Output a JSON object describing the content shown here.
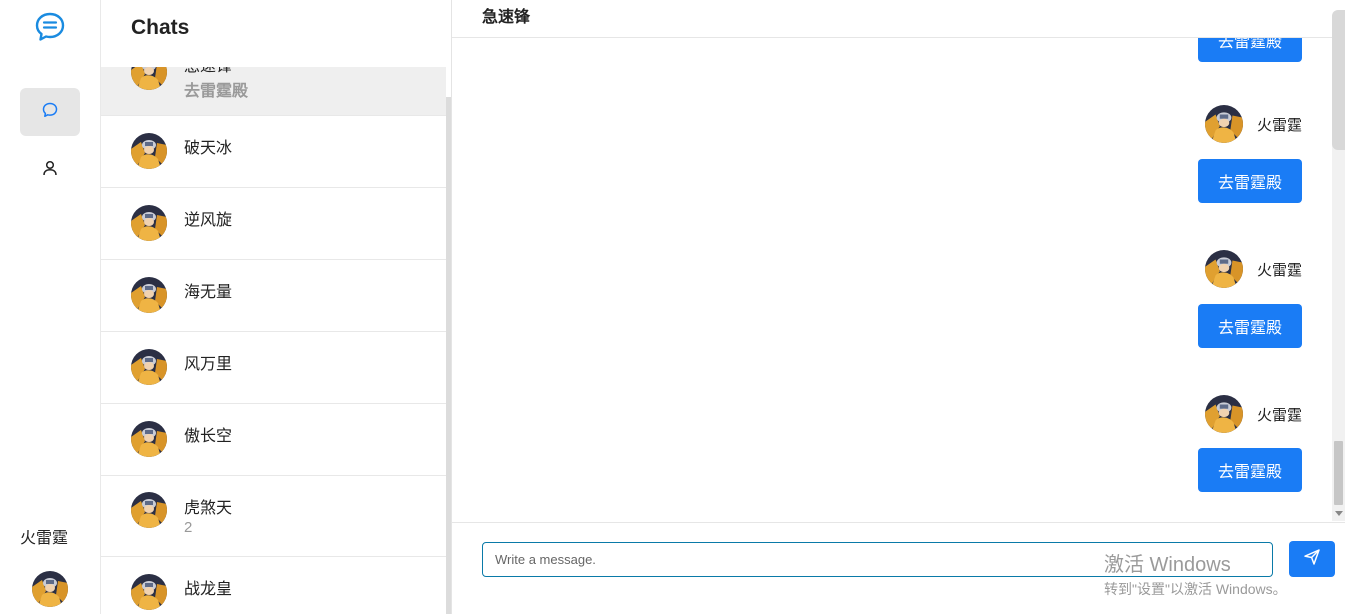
{
  "rail": {
    "current_user": "火雷霆"
  },
  "chat_list": {
    "title": "Chats",
    "items": [
      {
        "name": "急速锋",
        "preview": "去雷霆殿",
        "active": true
      },
      {
        "name": "破天冰",
        "preview": ""
      },
      {
        "name": "逆风旋",
        "preview": ""
      },
      {
        "name": "海无量",
        "preview": ""
      },
      {
        "name": "风万里",
        "preview": ""
      },
      {
        "name": "傲长空",
        "preview": ""
      },
      {
        "name": "虎煞天",
        "preview": "2"
      },
      {
        "name": "战龙皇",
        "preview": ""
      }
    ]
  },
  "conversation": {
    "title": "急速锋",
    "messages": [
      {
        "sender": "",
        "text": "去雷霆殿"
      },
      {
        "sender": "火雷霆",
        "text": "去雷霆殿"
      },
      {
        "sender": "火雷霆",
        "text": "去雷霆殿"
      },
      {
        "sender": "火雷霆",
        "text": "去雷霆殿"
      }
    ],
    "composer": {
      "placeholder": "Write a message."
    }
  },
  "watermark": {
    "line1": "激活 Windows",
    "line2": "转到\"设置\"以激活 Windows。"
  },
  "colors": {
    "accent": "#1a7cf5",
    "logo": "#1a8be0"
  }
}
